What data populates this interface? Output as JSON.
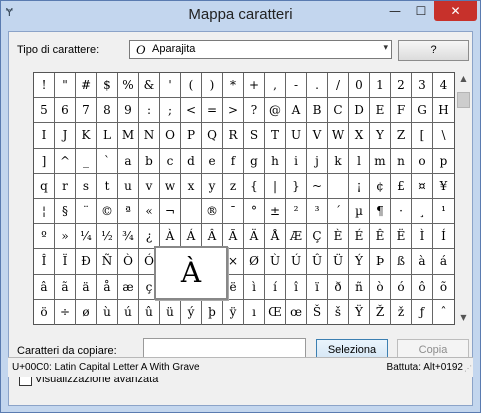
{
  "window": {
    "title": "Mappa caratteri",
    "app_icon": "character-map-icon",
    "minimize_glyph": "—",
    "maximize_glyph": "☐",
    "close_glyph": "✕"
  },
  "font": {
    "label": "Tipo di carattere:",
    "icon_glyph": "O",
    "value": "Aparajita",
    "dropdown_glyph": "▾"
  },
  "help_label": "?",
  "grid": {
    "columns": 20,
    "rows": [
      [
        "!",
        "\"",
        "#",
        "$",
        "%",
        "&",
        "'",
        "(",
        ")",
        "*",
        "+",
        ",",
        "-",
        ".",
        "/",
        "0",
        "1",
        "2",
        "3",
        "4"
      ],
      [
        "5",
        "6",
        "7",
        "8",
        "9",
        ":",
        ";",
        "<",
        "=",
        ">",
        "?",
        "@",
        "A",
        "B",
        "C",
        "D",
        "E",
        "F",
        "G",
        "H"
      ],
      [
        "I",
        "J",
        "K",
        "L",
        "M",
        "N",
        "O",
        "P",
        "Q",
        "R",
        "S",
        "T",
        "U",
        "V",
        "W",
        "X",
        "Y",
        "Z",
        "[",
        "\\"
      ],
      [
        "]",
        "^",
        "_",
        "`",
        "a",
        "b",
        "c",
        "d",
        "e",
        "f",
        "g",
        "h",
        "i",
        "j",
        "k",
        "l",
        "m",
        "n",
        "o",
        "p"
      ],
      [
        "q",
        "r",
        "s",
        "t",
        "u",
        "v",
        "w",
        "x",
        "y",
        "z",
        "{",
        "|",
        "}",
        "~",
        " ",
        "¡",
        "¢",
        "£",
        "¤",
        "¥"
      ],
      [
        "¦",
        "§",
        "¨",
        "©",
        "ª",
        "«",
        "¬",
        "",
        "®",
        "¯",
        "°",
        "±",
        "²",
        "³",
        "´",
        "µ",
        "¶",
        "·",
        "¸",
        "¹"
      ],
      [
        "º",
        "»",
        "¼",
        "½",
        "¾",
        "¿",
        "À",
        "Á",
        "Â",
        "Ã",
        "Ä",
        "Å",
        "Æ",
        "Ç",
        "È",
        "É",
        "Ê",
        "Ë",
        "Ì",
        "Í"
      ],
      [
        "Î",
        "Ï",
        "Ð",
        "Ñ",
        "Ò",
        "Ó",
        "Ô",
        "Õ",
        "Ö",
        "×",
        "Ø",
        "Ù",
        "Ú",
        "Û",
        "Ü",
        "Ý",
        "Þ",
        "ß",
        "à",
        "á"
      ],
      [
        "â",
        "ã",
        "ä",
        "å",
        "æ",
        "ç",
        "è",
        "é",
        "ê",
        "ë",
        "ì",
        "í",
        "î",
        "ï",
        "ð",
        "ñ",
        "ò",
        "ó",
        "ô",
        "õ"
      ],
      [
        "ö",
        "÷",
        "ø",
        "ù",
        "ú",
        "û",
        "ü",
        "ý",
        "þ",
        "ÿ",
        "ı",
        "Œ",
        "œ",
        "Š",
        "š",
        "Ÿ",
        "Ž",
        "ž",
        "ƒ",
        "ˆ"
      ]
    ],
    "selected_char": "À"
  },
  "scrollbar": {
    "up_glyph": "▲",
    "down_glyph": "▼"
  },
  "copy": {
    "label": "Caratteri da copiare:",
    "value": "",
    "select_label": "Seleziona",
    "copy_label": "Copia"
  },
  "advanced": {
    "label": "Visualizzazione avanzata",
    "checked": false
  },
  "status": {
    "left": "U+00C0: Latin Capital Letter A With Grave",
    "right": "Battuta: Alt+0192",
    "grip_glyph": "⋰"
  }
}
